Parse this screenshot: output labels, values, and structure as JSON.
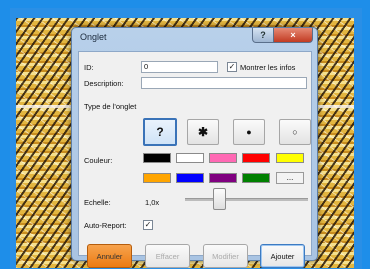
{
  "dialog": {
    "title": "Onglet",
    "help_glyph": "?",
    "close_glyph": "×"
  },
  "form": {
    "id_label": "ID:",
    "id_value": "0",
    "show_info_checked_glyph": "✓",
    "show_info_label": "Montrer les infos",
    "description_label": "Description:",
    "description_value": "",
    "type_label": "Type de l'onglet",
    "type_options": [
      "?",
      "✱",
      "●",
      "○"
    ],
    "colour_label": "Couleur:",
    "colours": [
      "#000000",
      "#ffffff",
      "#ff69b4",
      "#ff0000",
      "#ffff00",
      "#ffa500",
      "#0000ff",
      "#800080",
      "#008000"
    ],
    "more_colours": "...",
    "scale_label": "Echelle:",
    "scale_value": "1,0x",
    "auto_report_label": "Auto-Report:",
    "auto_report_glyph": "✓"
  },
  "buttons": {
    "cancel": "Annuler",
    "clear": "Effacer",
    "modify": "Modifier",
    "add": "Ajouter"
  }
}
